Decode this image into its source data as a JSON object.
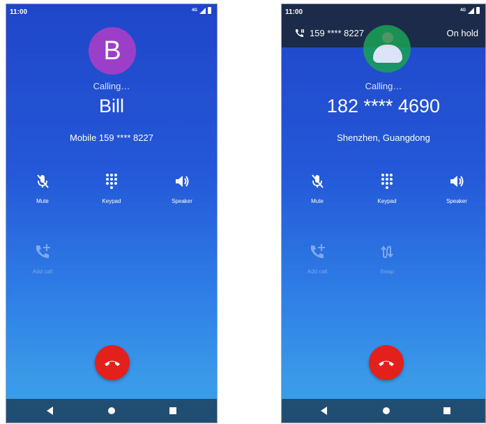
{
  "left_screen": {
    "status": {
      "time": "11:00",
      "network": "4G"
    },
    "avatar_letter": "B",
    "calling_label": "Calling…",
    "caller_name": "Bill",
    "caller_detail": "Mobile 159 **** 8227",
    "controls": [
      {
        "label": "Mute",
        "icon": "mute-icon"
      },
      {
        "label": "Keypad",
        "icon": "keypad-icon"
      },
      {
        "label": "Speaker",
        "icon": "speaker-icon"
      },
      {
        "label": "Add call",
        "icon": "add-call-icon"
      }
    ]
  },
  "right_screen": {
    "status": {
      "time": "11:00",
      "network": "4G"
    },
    "hold_bar": {
      "number": "159 **** 8227",
      "label": "On hold"
    },
    "calling_label": "Calling…",
    "caller_name": "182 **** 4690",
    "caller_detail": "Shenzhen, Guangdong",
    "controls": [
      {
        "label": "Mute",
        "icon": "mute-icon"
      },
      {
        "label": "Keypad",
        "icon": "keypad-icon"
      },
      {
        "label": "Speaker",
        "icon": "speaker-icon"
      },
      {
        "label": "Add call",
        "icon": "add-call-icon"
      },
      {
        "label": "Swap",
        "icon": "swap-icon"
      }
    ]
  },
  "colors": {
    "end_call": "#e3201c",
    "avatar_left": "#9c3fc8",
    "avatar_right": "#1aa254",
    "nav_bar": "#1f4e72",
    "hold_bar": "#1c2b4a"
  }
}
